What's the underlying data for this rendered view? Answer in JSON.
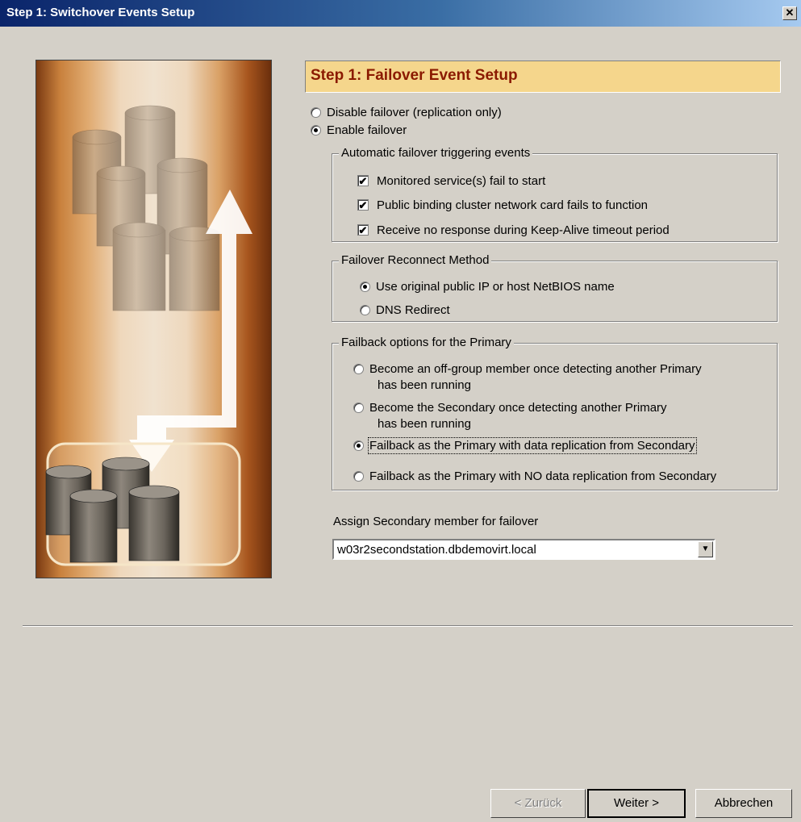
{
  "window": {
    "title": "Step 1: Switchover Events Setup",
    "close_label": "✕"
  },
  "header": {
    "title": "Step 1: Failover Event Setup"
  },
  "failover_mode": {
    "options": [
      {
        "label": "Disable failover (replication only)",
        "selected": false
      },
      {
        "label": "Enable failover",
        "selected": true
      }
    ]
  },
  "trigger_group": {
    "title": "Automatic failover triggering events",
    "items": [
      {
        "label": "Monitored service(s) fail to start",
        "checked": true
      },
      {
        "label": "Public binding cluster network card fails to function",
        "checked": true
      },
      {
        "label": "Receive no response during Keep-Alive timeout period",
        "checked": true
      }
    ]
  },
  "reconnect_group": {
    "title": "Failover Reconnect Method",
    "options": [
      {
        "label": "Use original public IP or host NetBIOS name",
        "selected": true
      },
      {
        "label": "DNS Redirect",
        "selected": false
      }
    ]
  },
  "failback_group": {
    "title": "Failback options for the Primary",
    "options": [
      {
        "line1": "Become an off-group member once detecting another Primary",
        "line2": "has been running",
        "selected": false
      },
      {
        "line1": "Become the Secondary once detecting another Primary",
        "line2": "has been running",
        "selected": false
      },
      {
        "line1": "Failback as the Primary with data replication from Secondary",
        "line2": "",
        "selected": true
      },
      {
        "line1": "Failback as the Primary with NO data replication from Secondary",
        "line2": "",
        "selected": false
      }
    ]
  },
  "secondary": {
    "label": "Assign Secondary member for failover",
    "selected_value": "w03r2secondstation.dbdemovirt.local"
  },
  "buttons": {
    "back": "< Zurück",
    "next": "Weiter >",
    "cancel": "Abbrechen"
  },
  "icons": {
    "dropdown_arrow": "▼",
    "checkmark": "✔"
  }
}
